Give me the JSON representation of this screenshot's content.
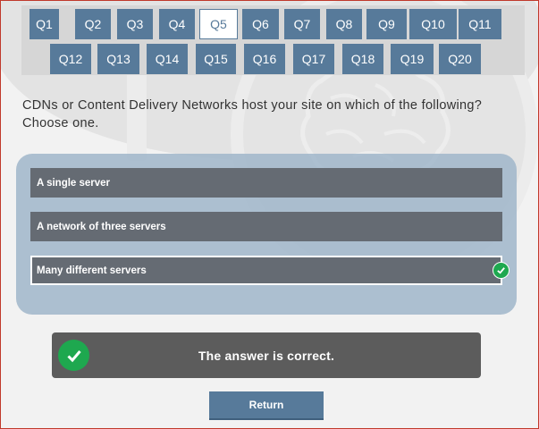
{
  "nav": {
    "questions": [
      "Q1",
      "Q2",
      "Q3",
      "Q4",
      "Q5",
      "Q6",
      "Q7",
      "Q8",
      "Q9",
      "Q10",
      "Q11",
      "Q12",
      "Q13",
      "Q14",
      "Q15",
      "Q16",
      "Q17",
      "Q18",
      "Q19",
      "Q20"
    ],
    "active": "Q5"
  },
  "question": {
    "text": "CDNs or Content Delivery Networks host your site on which of the following? Choose one."
  },
  "answers": [
    {
      "label": "A single server",
      "selected": false
    },
    {
      "label": "A network of three servers",
      "selected": false
    },
    {
      "label": "Many different servers",
      "selected": true,
      "marked_correct": true
    }
  ],
  "feedback": {
    "text": "The answer is correct.",
    "status": "correct",
    "icon": "check-icon"
  },
  "return_button": {
    "label": "Return"
  },
  "colors": {
    "accent": "#577a9a",
    "answer_bg": "#656b73",
    "panel_bg": "#a0b6ca",
    "success": "#1ea84f",
    "feedback_bg": "#5c5c5c"
  }
}
